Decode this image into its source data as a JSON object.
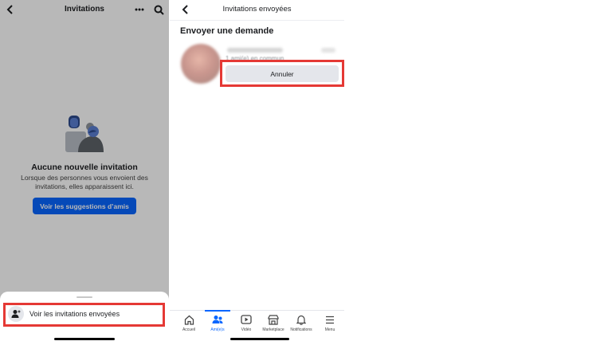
{
  "left": {
    "title": "Invitations",
    "empty_title": "Aucune nouvelle invitation",
    "empty_desc": "Lorsque des personnes vous envoient des invitations, elles apparaissent ici.",
    "suggest_button": "Voir les suggestions d’amis",
    "sheet_item": "Voir les invitations envoyées"
  },
  "right": {
    "title": "Invitations envoyées",
    "section_title": "Envoyer une demande",
    "request": {
      "mutual": "1 ami(e) en commun",
      "cancel_button": "Annuler"
    },
    "tabs": [
      {
        "label": "Accueil",
        "icon": "home-icon"
      },
      {
        "label": "Ami(e)s",
        "icon": "friends-icon",
        "active": true
      },
      {
        "label": "Vidéo",
        "icon": "video-icon"
      },
      {
        "label": "Marketplace",
        "icon": "marketplace-icon"
      },
      {
        "label": "Notifications",
        "icon": "bell-icon"
      },
      {
        "label": "Menu",
        "icon": "menu-icon"
      }
    ]
  },
  "colors": {
    "accent": "#0866ff",
    "highlight": "#e53935",
    "button_gray": "#e4e6eb"
  }
}
